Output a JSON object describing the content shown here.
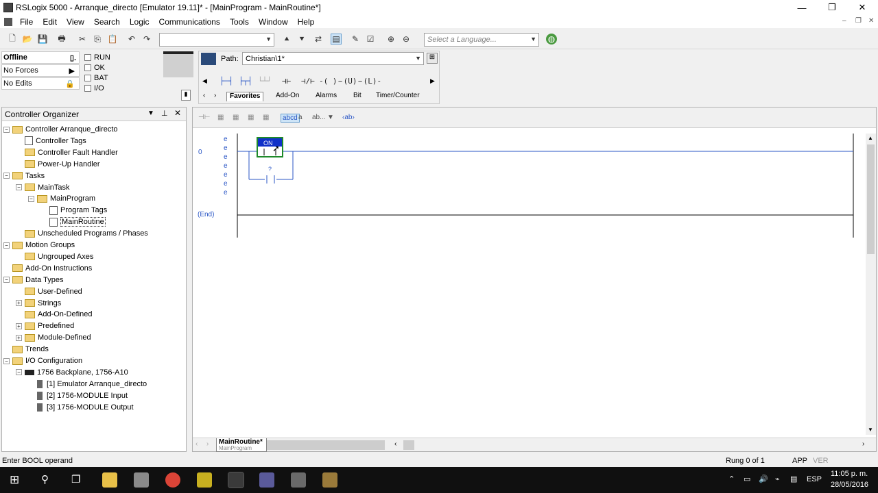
{
  "window": {
    "title": "RSLogix 5000 - Arranque_directo [Emulator 19.11]* - [MainProgram - MainRoutine*]",
    "minimize": "—",
    "restore": "❐",
    "close": "✕"
  },
  "menu": [
    "File",
    "Edit",
    "View",
    "Search",
    "Logic",
    "Communications",
    "Tools",
    "Window",
    "Help"
  ],
  "toolbar": {
    "language_placeholder": "Select a Language..."
  },
  "status": {
    "mode": "Offline",
    "forces": "No Forces",
    "edits": "No Edits",
    "checks": [
      "RUN",
      "OK",
      "BAT",
      "I/O"
    ]
  },
  "path": {
    "label": "Path:",
    "value": "Christian\\1*"
  },
  "ladder_tabs": [
    "Favorites",
    "Add-On",
    "Alarms",
    "Bit",
    "Timer/Counter"
  ],
  "ladder_buttons": [
    "⊣⊢",
    "⊣/⊢",
    "-( )-",
    "-(U)-",
    "-(L)-"
  ],
  "organizer": {
    "title": "Controller Organizer",
    "tree": [
      {
        "label": "Controller Arranque_directo",
        "level": 0,
        "icon": "folder",
        "exp": "−"
      },
      {
        "label": "Controller Tags",
        "level": 1,
        "icon": "tags"
      },
      {
        "label": "Controller Fault Handler",
        "level": 1,
        "icon": "folder"
      },
      {
        "label": "Power-Up Handler",
        "level": 1,
        "icon": "folder"
      },
      {
        "label": "Tasks",
        "level": 0,
        "icon": "folder",
        "exp": "−"
      },
      {
        "label": "MainTask",
        "level": 1,
        "icon": "task",
        "exp": "−"
      },
      {
        "label": "MainProgram",
        "level": 2,
        "icon": "program",
        "exp": "−"
      },
      {
        "label": "Program Tags",
        "level": 3,
        "icon": "tags"
      },
      {
        "label": "MainRoutine",
        "level": 3,
        "icon": "routine",
        "selected": true
      },
      {
        "label": "Unscheduled Programs / Phases",
        "level": 1,
        "icon": "folder"
      },
      {
        "label": "Motion Groups",
        "level": 0,
        "icon": "folder",
        "exp": "−"
      },
      {
        "label": "Ungrouped Axes",
        "level": 1,
        "icon": "folder"
      },
      {
        "label": "Add-On Instructions",
        "level": 0,
        "icon": "folder"
      },
      {
        "label": "Data Types",
        "level": 0,
        "icon": "folder",
        "exp": "−"
      },
      {
        "label": "User-Defined",
        "level": 1,
        "icon": "folder"
      },
      {
        "label": "Strings",
        "level": 1,
        "icon": "folder",
        "exp": "+"
      },
      {
        "label": "Add-On-Defined",
        "level": 1,
        "icon": "folder"
      },
      {
        "label": "Predefined",
        "level": 1,
        "icon": "folder",
        "exp": "+"
      },
      {
        "label": "Module-Defined",
        "level": 1,
        "icon": "folder",
        "exp": "+"
      },
      {
        "label": "Trends",
        "level": 0,
        "icon": "folder"
      },
      {
        "label": "I/O Configuration",
        "level": 0,
        "icon": "folder",
        "exp": "−"
      },
      {
        "label": "1756 Backplane, 1756-A10",
        "level": 1,
        "icon": "rack",
        "exp": "−"
      },
      {
        "label": "[1] Emulator Arranque_directo",
        "level": 2,
        "icon": "module"
      },
      {
        "label": "[2] 1756-MODULE Input",
        "level": 2,
        "icon": "module"
      },
      {
        "label": "[3] 1756-MODULE Output",
        "level": 2,
        "icon": "module"
      }
    ]
  },
  "ladder": {
    "rung_number": "0",
    "end_label": "(End)",
    "edit_markers": [
      "e",
      "e",
      "e",
      "e",
      "e",
      "e",
      "e"
    ],
    "instr_label": "ON",
    "branch_tag": "?",
    "sheet_tab": "MainRoutine*",
    "sheet_tab_sub": "MainProgram"
  },
  "statusbar": {
    "message": "Enter BOOL operand",
    "rung": "Rung 0 of 1",
    "app": "APP",
    "ver": "VER"
  },
  "taskbar": {
    "lang": "ESP",
    "time": "11:05 p. m.",
    "date": "28/05/2016"
  }
}
